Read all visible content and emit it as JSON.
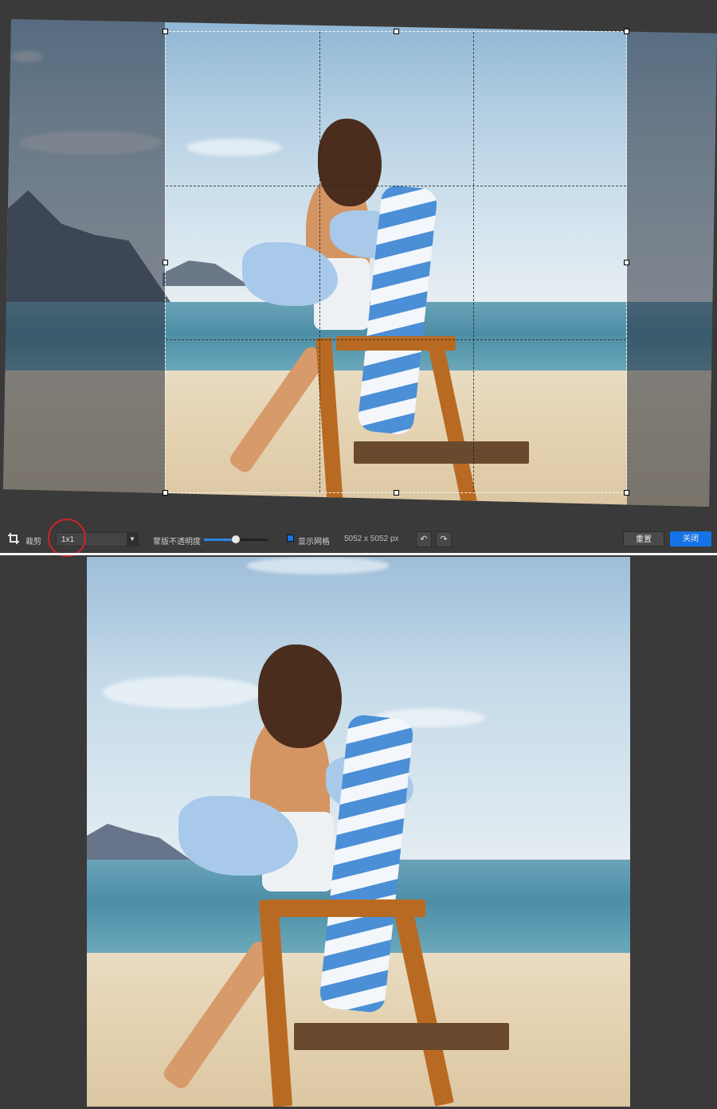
{
  "toolbar": {
    "tool_label": "裁剪",
    "aspect_ratio_value": "1x1",
    "opacity_label": "蒙版不透明度",
    "opacity_level": 0.5,
    "show_grid_label": "显示网格",
    "show_grid_checked": true,
    "dimensions": "5052 x 5052 px",
    "reset_label": "重置",
    "close_label": "关闭"
  },
  "colors": {
    "accent": "#1473e6",
    "highlight": "#c92626",
    "background": "#3a3a3a"
  },
  "icons": [
    "crop-icon",
    "chevron-down-icon",
    "rotate-left-icon",
    "rotate-right-icon"
  ]
}
